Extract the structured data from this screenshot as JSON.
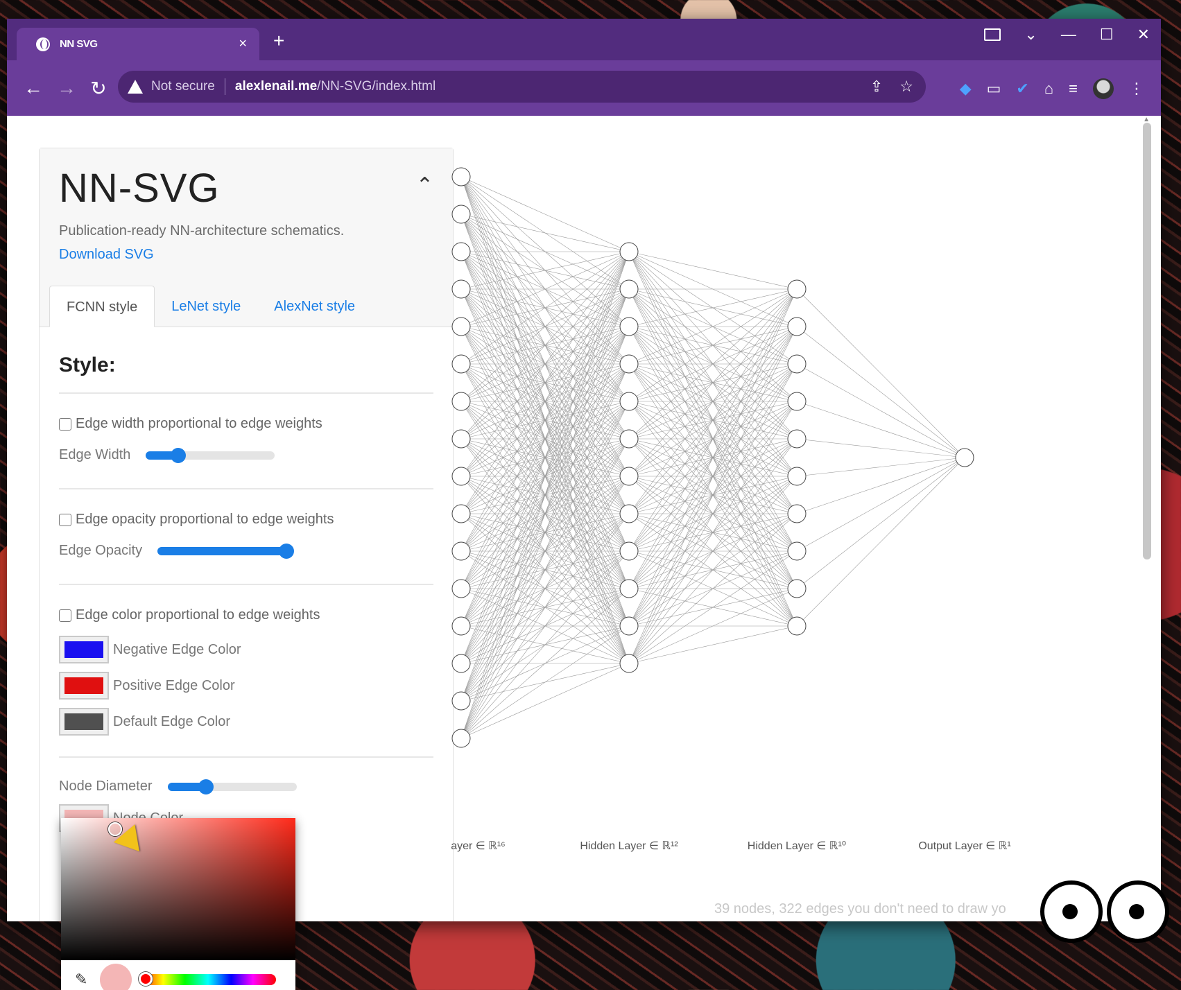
{
  "browser": {
    "tab_title": "NN SVG",
    "tab_close": "×",
    "new_tab": "+",
    "security_label": "Not secure",
    "url_host": "alexlenail.me",
    "url_path": "/NN-SVG/index.html"
  },
  "panel": {
    "title": "NN-SVG",
    "subtitle": "Publication-ready NN-architecture schematics.",
    "download": "Download SVG",
    "tabs": [
      "FCNN style",
      "LeNet style",
      "AlexNet style"
    ],
    "style_heading": "Style:",
    "edge_width_check": "Edge width proportional to edge weights",
    "edge_width_label": "Edge Width",
    "edge_width_value": 0.25,
    "edge_opacity_check": "Edge opacity proportional to edge weights",
    "edge_opacity_label": "Edge Opacity",
    "edge_opacity_value": 1.0,
    "edge_color_check": "Edge color proportional to edge weights",
    "negative_color_label": "Negative Edge Color",
    "positive_color_label": "Positive Edge Color",
    "default_color_label": "Default Edge Color",
    "node_diameter_label": "Node Diameter",
    "node_diameter_value": 0.3,
    "node_color_label": "Node Color"
  },
  "colors": {
    "negative": "#1a10f0",
    "positive": "#e01010",
    "default": "#505050",
    "node": "#f4b6b6",
    "accent": "#1a7ee6",
    "chrome": "#6a3d9a"
  },
  "network": {
    "layers": [
      16,
      12,
      10,
      1
    ],
    "labels": [
      "Input Layer ∈ ℝ¹⁶",
      "Hidden Layer ∈ ℝ¹²",
      "Hidden Layer ∈ ℝ¹⁰",
      "Output Layer ∈ ℝ¹"
    ]
  },
  "footer_note": "39 nodes, 322 edges you don't need to draw yo"
}
